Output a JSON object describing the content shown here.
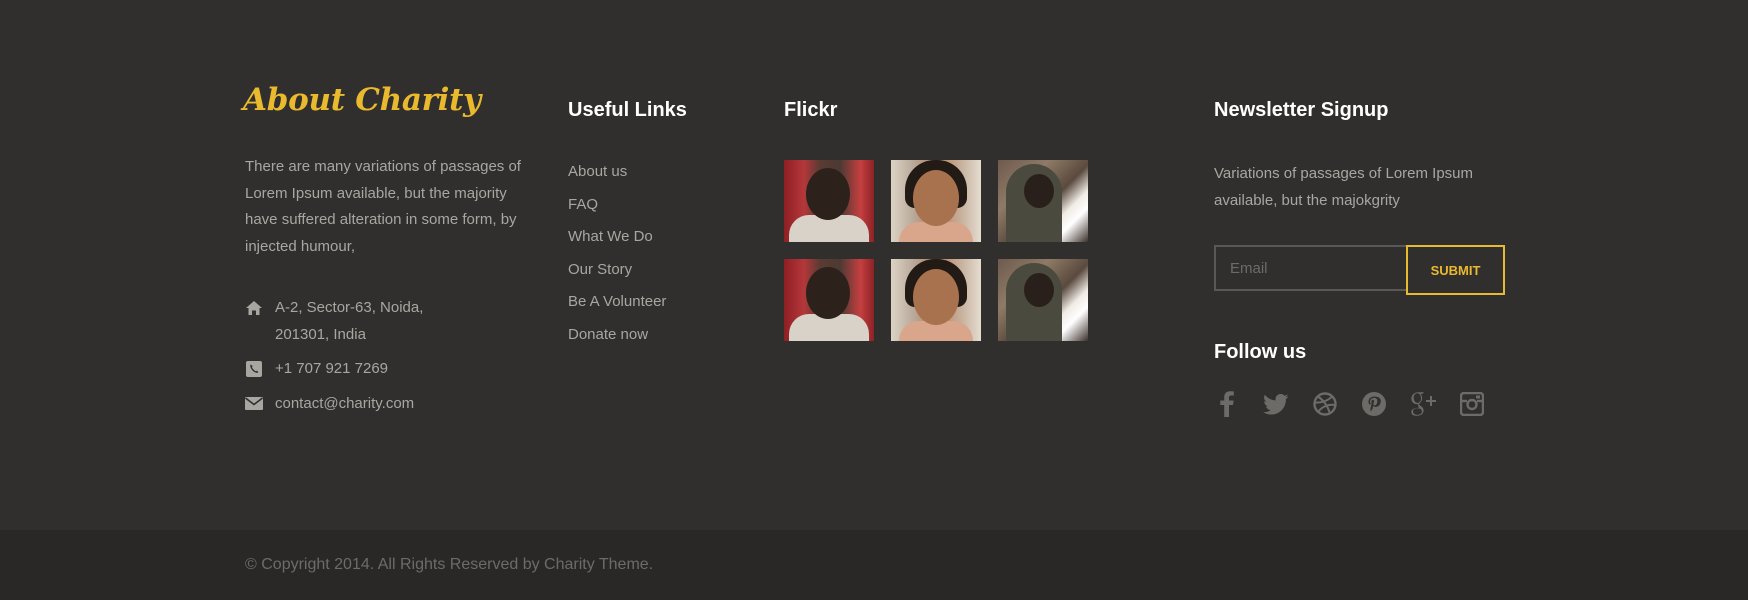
{
  "colors": {
    "accent": "#e9b92e",
    "background": "#312f2d",
    "bottom_bar": "#292827",
    "text_muted": "#a9a6a2"
  },
  "about": {
    "title": "About Charity",
    "text": "There are many variations of passages of Lorem Ipsum available, but the majority have suffered alteration in some form, by injected humour,",
    "address": "A-2, Sector-63, Noida, 201301, India",
    "phone": "+1 707 921 7269",
    "email": "contact@charity.com",
    "icons": [
      "home-icon",
      "phone-icon",
      "envelope-icon"
    ]
  },
  "useful_links": {
    "title": "Useful Links",
    "items": [
      {
        "label": "About us"
      },
      {
        "label": "FAQ"
      },
      {
        "label": "What We Do"
      },
      {
        "label": "Our Story"
      },
      {
        "label": "Be A Volunteer"
      },
      {
        "label": "Donate now"
      }
    ]
  },
  "flickr": {
    "title": "Flickr",
    "photos": [
      "child-photo-1",
      "child-photo-2",
      "child-photo-3",
      "child-photo-1",
      "child-photo-2",
      "child-photo-3"
    ]
  },
  "newsletter": {
    "title": "Newsletter Signup",
    "text": "Variations of passages of Lorem Ipsum available, but the majokgrity",
    "email_placeholder": "Email",
    "submit_label": "SUBMIT"
  },
  "follow": {
    "title": "Follow us",
    "icons": [
      "facebook-icon",
      "twitter-icon",
      "dribbble-icon",
      "pinterest-icon",
      "google-plus-icon",
      "instagram-icon"
    ]
  },
  "footer": {
    "copyright": "© Copyright 2014. All Rights Reserved by Charity Theme."
  }
}
